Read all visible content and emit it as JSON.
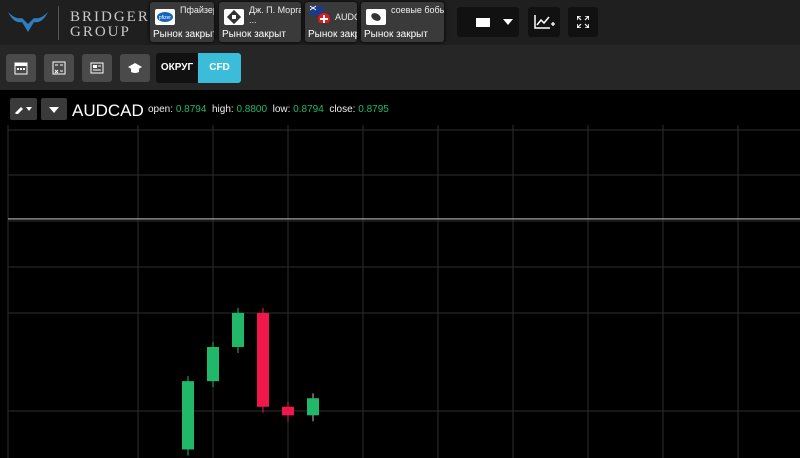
{
  "brand": {
    "line1": "BRIDGER",
    "line2": "GROUP"
  },
  "tabs": [
    {
      "name": "Пфайзер Инк",
      "status": "Рынок закрыт",
      "icon": "pfizer-logo-icon"
    },
    {
      "name": "Дж. П. Морган ...",
      "status": "Рынок закрыт",
      "icon": "jpmorgan-logo-icon"
    },
    {
      "name": "AUDCHF",
      "status": "Рынок закрыт",
      "icon": "au-ch-flags-icon"
    },
    {
      "name": "соевые бобы",
      "status": "Рынок закрыт",
      "icon": "soybean-icon"
    }
  ],
  "toolbar": {
    "toggle_left": "ОКРУГ",
    "toggle_right": "CFD"
  },
  "chart_header": {
    "symbol": "AUDCAD",
    "open_label": "open:",
    "open": "0.8794",
    "high_label": "high:",
    "high": "0.8800",
    "low_label": "low:",
    "low": "0.8794",
    "close_label": "close:",
    "close": "0.8795"
  },
  "colors": {
    "up": "#21b86a",
    "down": "#f0184a",
    "accent": "#3bbcd9",
    "grid": "#2e2e2e"
  },
  "chart_data": {
    "type": "candlestick",
    "candles": [
      {
        "dir": "up",
        "open": 0.8785,
        "close": 0.8793
      },
      {
        "dir": "up",
        "open": 0.8793,
        "close": 0.8797
      },
      {
        "dir": "up",
        "open": 0.8797,
        "close": 0.8801
      },
      {
        "dir": "down",
        "open": 0.8801,
        "close": 0.879
      },
      {
        "dir": "down",
        "open": 0.879,
        "close": 0.8789
      },
      {
        "dir": "up",
        "open": 0.8789,
        "close": 0.8791
      }
    ],
    "ylim": [
      0.8784,
      0.8823
    ],
    "price_line": 0.8812,
    "grid": true
  }
}
